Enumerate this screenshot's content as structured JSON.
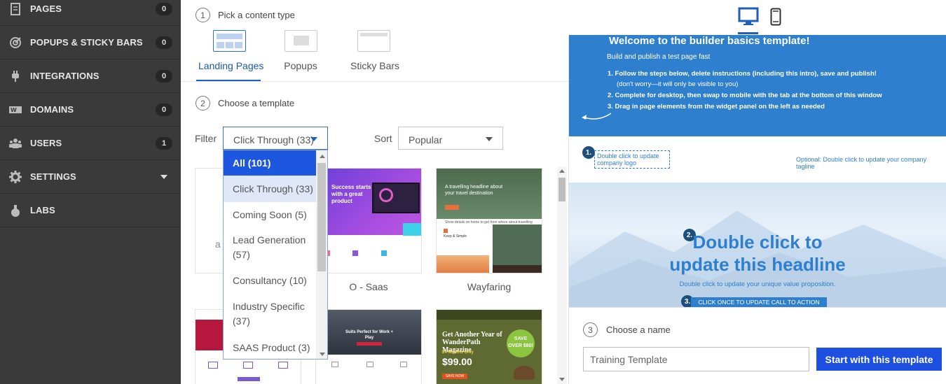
{
  "sidebar": {
    "items": [
      {
        "label": "PAGES",
        "badge": "0",
        "icon": "pages-icon"
      },
      {
        "label": "POPUPS & STICKY BARS",
        "badge": "0",
        "icon": "target-icon"
      },
      {
        "label": "INTEGRATIONS",
        "badge": "0",
        "icon": "plug-icon"
      },
      {
        "label": "DOMAINS",
        "badge": "0",
        "icon": "domain-icon"
      },
      {
        "label": "USERS",
        "badge": "1",
        "icon": "users-icon"
      },
      {
        "label": "SETTINGS",
        "icon": "gear-icon"
      },
      {
        "label": "LABS",
        "icon": "flask-icon"
      }
    ]
  },
  "step1": {
    "number": "1",
    "label": "Pick a content type"
  },
  "content_types": [
    {
      "label": "Landing Pages",
      "active": true
    },
    {
      "label": "Popups"
    },
    {
      "label": "Sticky Bars"
    }
  ],
  "step2": {
    "number": "2",
    "label": "Choose a template"
  },
  "filter": {
    "label": "Filter",
    "value": "Click Through (33)"
  },
  "sort": {
    "label": "Sort",
    "value": "Popular"
  },
  "filter_options": [
    "All (101)",
    "Click Through (33)",
    "Coming Soon (5)",
    "Lead Generation (57)",
    "Consultancy (10)",
    "Industry Specific (37)",
    "SAAS Product (3)"
  ],
  "templates": [
    {
      "title": "O - Saas"
    },
    {
      "title": "Wayfaring"
    }
  ],
  "thumb_text": {
    "card1_letter": "a",
    "saas_headline": "Success starts with a great product",
    "wayfaring_headline": "A travelling headline about your travel destination",
    "wayfaring_sub": "Show details on home to get from where about travelling",
    "wayfaring_item": "Keep & Simple",
    "work_play": "Suits Perfect for Work + Play",
    "wander_title": "Get Another Year of WanderPath Magazine",
    "wander_save": "SAVE OVER $80!",
    "wander_price": "$99.00",
    "wander_price_note": "24 Months Only",
    "wander_cta": "SAVE NOW"
  },
  "preview": {
    "title": "Welcome to the builder basics template!",
    "subtitle": "Build and publish a test page fast",
    "steps": [
      "1.  Follow the steps below, delete instructions (including this intro), save and publish!",
      "(don't worry—it will only be visible to you)",
      "2.  Complete for desktop, then swap to mobile with the tab at the bottom of this window",
      "3.  Drag in page elements from the widget panel on the left as needed"
    ],
    "logo_badge": "1.",
    "logo_text": "Double click to update company logo",
    "tagline": "Optional: Double click to update your company tagline",
    "headline_badge": "2.",
    "headline": "Double click to update this headline",
    "value_prop": "Double click to update your unique value proposition.",
    "cta_badge": "3.",
    "cta": "CLICK ONCE TO UPDATE CALL TO ACTION"
  },
  "step3": {
    "number": "3",
    "label": "Choose a name"
  },
  "name_input": {
    "value": "Training Template"
  },
  "start_button": "Start with this template",
  "colors": {
    "sidebar_bg": "#3a3a3a",
    "accent": "#1d4fe0",
    "preview_blue": "#2f7fcf"
  }
}
